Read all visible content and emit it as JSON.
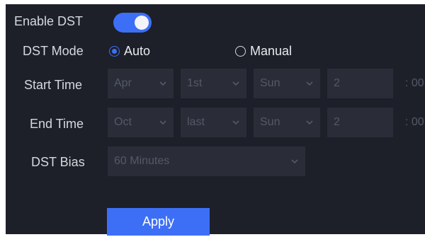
{
  "enable_dst": {
    "label": "Enable DST",
    "enabled": true
  },
  "dst_mode": {
    "label": "DST Mode",
    "options": [
      {
        "label": "Auto",
        "selected": true
      },
      {
        "label": "Manual",
        "selected": false
      }
    ]
  },
  "start_time": {
    "label": "Start Time",
    "month": "Apr",
    "week": "1st",
    "day": "Sun",
    "hour": "2",
    "minute": ": 00"
  },
  "end_time": {
    "label": "End Time",
    "month": "Oct",
    "week": "last",
    "day": "Sun",
    "hour": "2",
    "minute": ": 00"
  },
  "dst_bias": {
    "label": "DST Bias",
    "value": "60 Minutes"
  },
  "apply_label": "Apply",
  "colors": {
    "accent": "#3d6ff6",
    "panel": "#1d2029",
    "field": "#2a2d37",
    "disabled_text": "#545968"
  },
  "icons": {
    "dropdown": "chevron-down-icon"
  }
}
